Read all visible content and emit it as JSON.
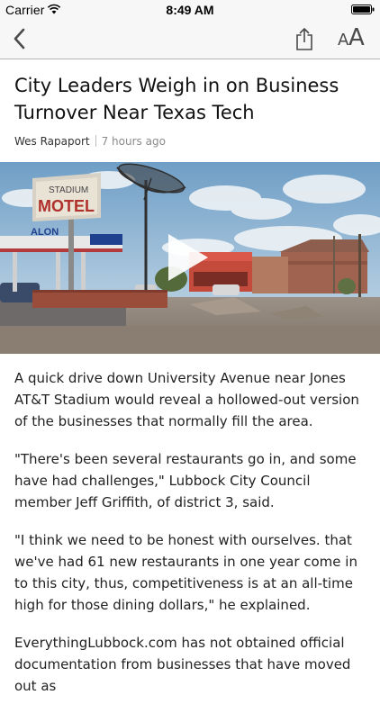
{
  "status_bar": {
    "carrier": "Carrier",
    "time": "8:49 AM"
  },
  "nav": {
    "back_icon": "chevron-left-icon",
    "share_icon": "share-icon",
    "font_size_small": "A",
    "font_size_large": "A"
  },
  "article": {
    "headline": "City Leaders Weigh in on Business Turnover Near Texas Tech",
    "author": "Wes Rapaport",
    "time_ago": "7 hours ago",
    "video": {
      "sign_top": "STADIUM",
      "sign_main": "MOTEL",
      "gas_sign": "ALON",
      "play_icon": "play-icon"
    },
    "paragraphs": [
      "A quick drive down University Avenue near Jones AT&T Stadium would reveal a hollowed-out version of the businesses that normally fill the area.",
      "\"There's been several restaurants go in, and some have had challenges,\" Lubbock City Council member Jeff Griffith, of district 3, said.",
      "\"I think we need to be honest with ourselves. that we've had 61 new restaurants in one year come in to this city, thus, competitiveness is at an all-time high for those dining dollars,\" he explained.",
      "EverythingLubbock.com has not obtained official documentation from businesses that have moved out as"
    ]
  },
  "colors": {
    "nav_background": "#f7f7f7",
    "icon_gray": "#4a4a4a",
    "byline_time": "#8a8a8a"
  }
}
